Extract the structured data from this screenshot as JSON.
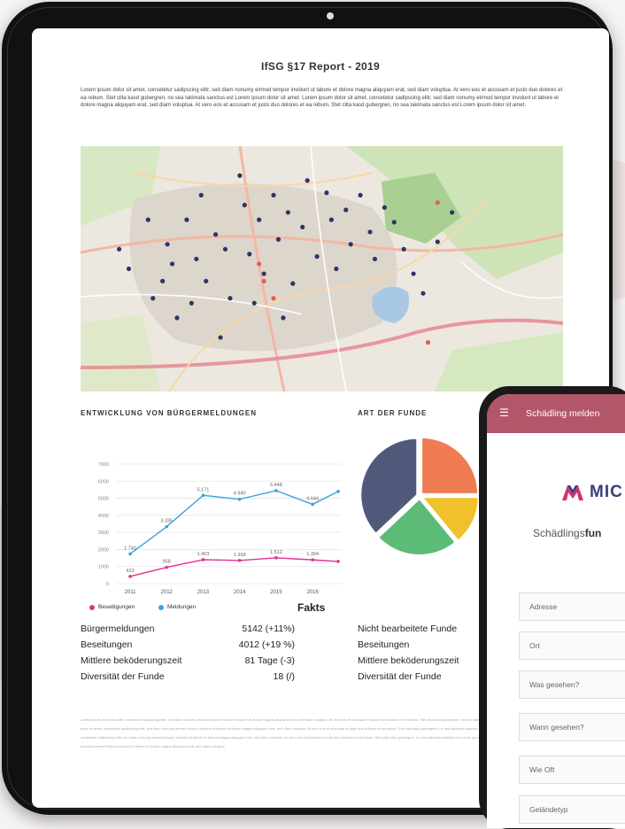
{
  "report": {
    "title": "IfSG §17 Report - 2019",
    "intro": "Lorem ipsum dolor sit amet, consetetur sadipscing elitr, sed diam nonumy eirmod tempor invidunt ut labore et dolore magna aliquyam erat, sed diam voluptua. At vero eos et accusam et justo duo dolores et ea rebum. Stet clita kasd gubergren, no sea takimata sanctus est Lorem ipsum dolor sit amet. Lorem ipsum dolor sit amet, consetetur sadipscing elitr, sed diam nonumy eirmod tempor invidunt ut labore et dolore magna aliquyam erat, sed diam voluptua. At vero eos et accusam et justo duo dolores et ea rebum. Stet clita kasd gubergren, no sea takimata sanctus est Lorem ipsum dolor sit amet.",
    "footer_text": "Lorem ipsum dolor sit amet, consetetur sadipscing elitr, sed diam nonumy eirmod tempor invidunt ut labore et dolore magna aliquyam erat, sed diam voluptua. At vero eos et accusam et justo duo dolores et ea rebum. Stet clita kasd gubergren, no sea takimata sanctus est Lorem ipsum dolor sit amet. Lorem ipsum dolor sit amet, consetetur sadipscing elitr, sed diam nonumy eirmod tempor invidunt ut labore et dolore magna aliquyam erat, sed diam voluptua. At vero eos et accusam et justo duo dolores et ea rebum. Stet clita kasd gubergren, no sea takimata sanctus est Lorem ipsum dolor sit amet. Lorem ipsum dolor sit amet, consetetur sadipscing elitr, sed diam nonumy eirmod tempor invidunt ut labore et dolore magna aliquyam erat, sed diam voluptua. At vero eos et accusam et justo duo dolores et ea rebum. Stet clita kasd gubergren, no sea takimata sanctus est Lorem ipsum dolor sit amet, consetetur sadipscing elitr, sed diam nonumy eirmod tempor invidunt ut labore et dolore magna aliquyam erat, sed diam voluptua."
  },
  "sections": {
    "entwicklung": "ENTWICKLUNG VON BÜRGERMELDUNGEN",
    "art": "ART DER FUNDE",
    "fakts": "Fakts"
  },
  "legend": {
    "beseitigungen": "Beseitigungen",
    "meldungen": "Meldungen"
  },
  "colors": {
    "beseitigungen": "#e0338d",
    "meldungen": "#3aa3dc",
    "brand_bar": "#b3566a",
    "logo_blue": "#3a3d7a",
    "logo_pink": "#d4316e"
  },
  "chart_data": [
    {
      "type": "line",
      "title": "ENTWICKLUNG VON BÜRGERMELDUNGEN",
      "x": [
        "2011",
        "2012",
        "2013",
        "2014",
        "2015",
        "2016"
      ],
      "ylim": [
        0,
        7000
      ],
      "yticks": [
        0,
        1000,
        2000,
        3000,
        4000,
        5000,
        6000,
        7000
      ],
      "series": [
        {
          "name": "Meldungen",
          "values": [
            1740,
            3335,
            5171,
            4940,
            5448,
            4644,
            5400
          ],
          "x_positions": [
            2011,
            2012,
            2013,
            2014,
            2015,
            2016,
            2016.7
          ],
          "labels": [
            "1.740",
            "3.335",
            "5.171",
            "4.940",
            "5.448",
            "4.644",
            ""
          ]
        },
        {
          "name": "Beseitigungen",
          "values": [
            423,
            958,
            1403,
            1359,
            1512,
            1394,
            1300
          ],
          "x_positions": [
            2011,
            2012,
            2013,
            2014,
            2015,
            2016,
            2016.7
          ],
          "labels": [
            "423",
            "958",
            "1.403",
            "1.359",
            "1.512",
            "1.394",
            ""
          ]
        }
      ],
      "legend": "bottom-left"
    },
    {
      "type": "pie",
      "title": "ART DER FUNDE",
      "slices": [
        {
          "value": 25,
          "color": "#ef7b52"
        },
        {
          "value": 14,
          "color": "#efc12b"
        },
        {
          "value": 24,
          "color": "#5dbb78"
        },
        {
          "value": 37,
          "color": "#4f5a7b"
        }
      ]
    }
  ],
  "facts_left": [
    {
      "label": "Bürgermeldungen",
      "value": "5142 (+11%)"
    },
    {
      "label": "Beseitungen",
      "value": "4012 (+19 %)"
    },
    {
      "label": "Mittlere beköderungszeit",
      "value": "81 Tage (-3)"
    },
    {
      "label": "Diversität der Funde",
      "value": "18  (/)"
    }
  ],
  "facts_right": [
    {
      "label": "Nicht bearbeitete Funde"
    },
    {
      "label": "Beseitungen"
    },
    {
      "label": "Mittlere beköderungszeit"
    },
    {
      "label": "Diversität der Funde"
    }
  ],
  "phone": {
    "title": "Schädling melden",
    "logo_text": "MIC",
    "subtitle_pre": "Schädlings",
    "subtitle_bold": "fun",
    "fields": [
      "Adresse",
      "Ort",
      "Was gesehen?",
      "Wann gesehen?",
      "Wie Oft",
      "Geländetyp"
    ]
  },
  "map": {
    "markers_blue": [
      [
        0.08,
        0.42
      ],
      [
        0.1,
        0.5
      ],
      [
        0.14,
        0.3
      ],
      [
        0.15,
        0.62
      ],
      [
        0.17,
        0.55
      ],
      [
        0.19,
        0.48
      ],
      [
        0.2,
        0.7
      ],
      [
        0.22,
        0.3
      ],
      [
        0.24,
        0.46
      ],
      [
        0.25,
        0.2
      ],
      [
        0.26,
        0.55
      ],
      [
        0.28,
        0.36
      ],
      [
        0.3,
        0.42
      ],
      [
        0.31,
        0.62
      ],
      [
        0.33,
        0.12
      ],
      [
        0.34,
        0.24
      ],
      [
        0.35,
        0.44
      ],
      [
        0.37,
        0.3
      ],
      [
        0.38,
        0.52
      ],
      [
        0.4,
        0.2
      ],
      [
        0.41,
        0.38
      ],
      [
        0.43,
        0.27
      ],
      [
        0.44,
        0.56
      ],
      [
        0.46,
        0.33
      ],
      [
        0.47,
        0.14
      ],
      [
        0.49,
        0.45
      ],
      [
        0.51,
        0.19
      ],
      [
        0.52,
        0.3
      ],
      [
        0.53,
        0.5
      ],
      [
        0.55,
        0.26
      ],
      [
        0.56,
        0.4
      ],
      [
        0.58,
        0.2
      ],
      [
        0.6,
        0.35
      ],
      [
        0.61,
        0.46
      ],
      [
        0.63,
        0.25
      ],
      [
        0.65,
        0.31
      ],
      [
        0.67,
        0.42
      ],
      [
        0.69,
        0.52
      ],
      [
        0.71,
        0.6
      ],
      [
        0.74,
        0.39
      ],
      [
        0.77,
        0.27
      ],
      [
        0.36,
        0.64
      ],
      [
        0.42,
        0.7
      ],
      [
        0.29,
        0.78
      ],
      [
        0.18,
        0.4
      ],
      [
        0.23,
        0.64
      ]
    ],
    "markers_red": [
      [
        0.37,
        0.48
      ],
      [
        0.4,
        0.62
      ],
      [
        0.38,
        0.55
      ],
      [
        0.74,
        0.23
      ],
      [
        0.72,
        0.8
      ]
    ]
  }
}
